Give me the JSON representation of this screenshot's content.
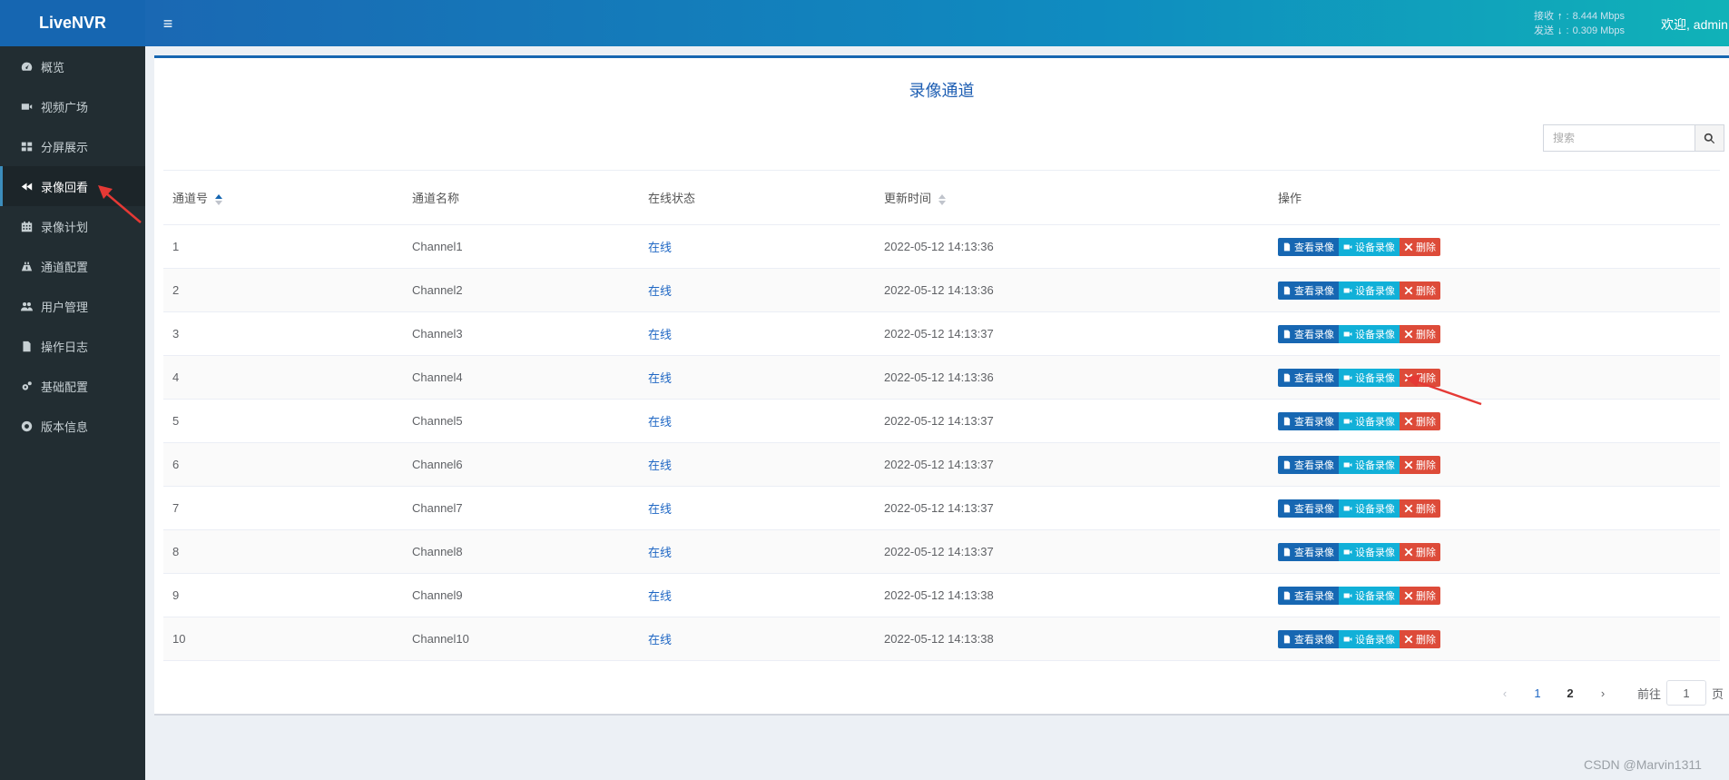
{
  "app": {
    "title": "LiveNVR"
  },
  "header": {
    "menu_icon": "hamburger-icon",
    "receive_label": "接收",
    "receive_rate": "8.444 Mbps",
    "send_label": "发送",
    "send_rate": "0.309 Mbps",
    "welcome": "欢迎, admin"
  },
  "sidebar": {
    "items": [
      {
        "label": "概览",
        "icon": "dashboard-icon"
      },
      {
        "label": "视频广场",
        "icon": "video-camera-icon"
      },
      {
        "label": "分屏展示",
        "icon": "grid-icon"
      },
      {
        "label": "录像回看",
        "icon": "backward-icon",
        "active": true
      },
      {
        "label": "录像计划",
        "icon": "calendar-icon"
      },
      {
        "label": "通道配置",
        "icon": "road-icon"
      },
      {
        "label": "用户管理",
        "icon": "users-icon"
      },
      {
        "label": "操作日志",
        "icon": "file-icon"
      },
      {
        "label": "基础配置",
        "icon": "cogs-icon"
      },
      {
        "label": "版本信息",
        "icon": "lifebuoy-icon"
      }
    ]
  },
  "main": {
    "title": "录像通道",
    "search_placeholder": "搜索",
    "columns": [
      "通道号",
      "通道名称",
      "在线状态",
      "更新时间",
      "操作"
    ],
    "rows": [
      {
        "id": "1",
        "name": "Channel1",
        "status": "在线",
        "time": "2022-05-12 14:13:36"
      },
      {
        "id": "2",
        "name": "Channel2",
        "status": "在线",
        "time": "2022-05-12 14:13:36"
      },
      {
        "id": "3",
        "name": "Channel3",
        "status": "在线",
        "time": "2022-05-12 14:13:37"
      },
      {
        "id": "4",
        "name": "Channel4",
        "status": "在线",
        "time": "2022-05-12 14:13:36"
      },
      {
        "id": "5",
        "name": "Channel5",
        "status": "在线",
        "time": "2022-05-12 14:13:37"
      },
      {
        "id": "6",
        "name": "Channel6",
        "status": "在线",
        "time": "2022-05-12 14:13:37"
      },
      {
        "id": "7",
        "name": "Channel7",
        "status": "在线",
        "time": "2022-05-12 14:13:37"
      },
      {
        "id": "8",
        "name": "Channel8",
        "status": "在线",
        "time": "2022-05-12 14:13:37"
      },
      {
        "id": "9",
        "name": "Channel9",
        "status": "在线",
        "time": "2022-05-12 14:13:38"
      },
      {
        "id": "10",
        "name": "Channel10",
        "status": "在线",
        "time": "2022-05-12 14:13:38"
      }
    ],
    "actions": {
      "view": "查看录像",
      "device": "设备录像",
      "delete": "删除"
    },
    "pagination": {
      "pages": [
        "1",
        "2"
      ],
      "current": "1",
      "goto_label": "前往",
      "goto_value": "1",
      "page_suffix": "页"
    }
  },
  "watermark": "CSDN @Marvin1311",
  "colors": {
    "brand": "#1666b1",
    "sidebar": "#222d32",
    "view_btn": "#1767b2",
    "device_btn": "#11b0d8",
    "delete_btn": "#dd4b39",
    "annotation": "#e53935"
  }
}
